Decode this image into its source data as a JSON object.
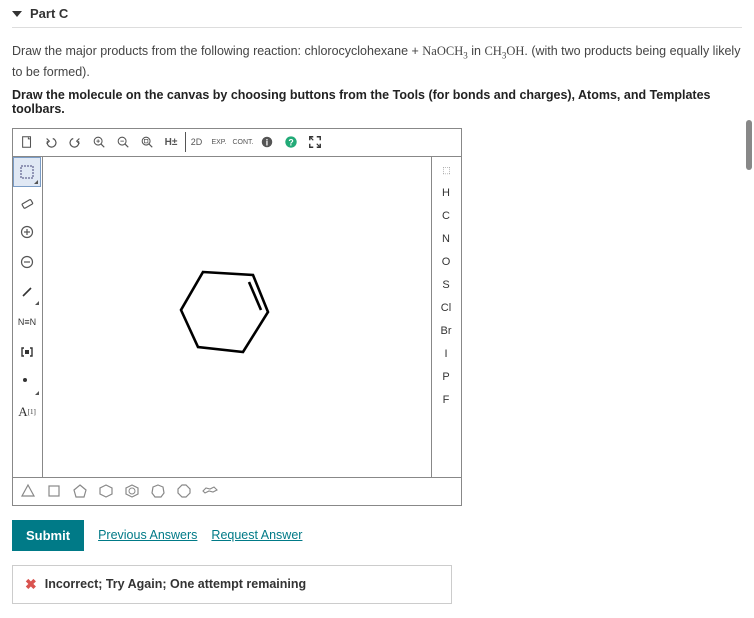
{
  "part": {
    "title": "Part C"
  },
  "instruction_pre": "Draw the major products from the following reaction: chlorocyclohexane + ",
  "reagent1": "NaOCH",
  "reagent1_sub": "3",
  "instruction_mid": " in ",
  "reagent2": "CH",
  "reagent2_sub": "3",
  "reagent2_end": "OH",
  "instruction_post": ". (with two products being equally likely to be formed).",
  "instruction2": "Draw the molecule on the canvas by choosing buttons from the Tools (for bonds and charges), Atoms, and Templates toolbars.",
  "toolbar": {
    "h_label": "H±",
    "d2_label": "2D",
    "exp_label": "EXP.",
    "cont_label": "CONT."
  },
  "atoms": {
    "head": "⬚",
    "H": "H",
    "C": "C",
    "N": "N",
    "O": "O",
    "S": "S",
    "Cl": "Cl",
    "Br": "Br",
    "I": "I",
    "P": "P",
    "F": "F"
  },
  "left": {
    "nn": "N≡N",
    "A": "A"
  },
  "actions": {
    "submit": "Submit",
    "prev": "Previous Answers",
    "request": "Request Answer"
  },
  "feedback": {
    "x": "✖",
    "text": "Incorrect; Try Again; One attempt remaining"
  }
}
